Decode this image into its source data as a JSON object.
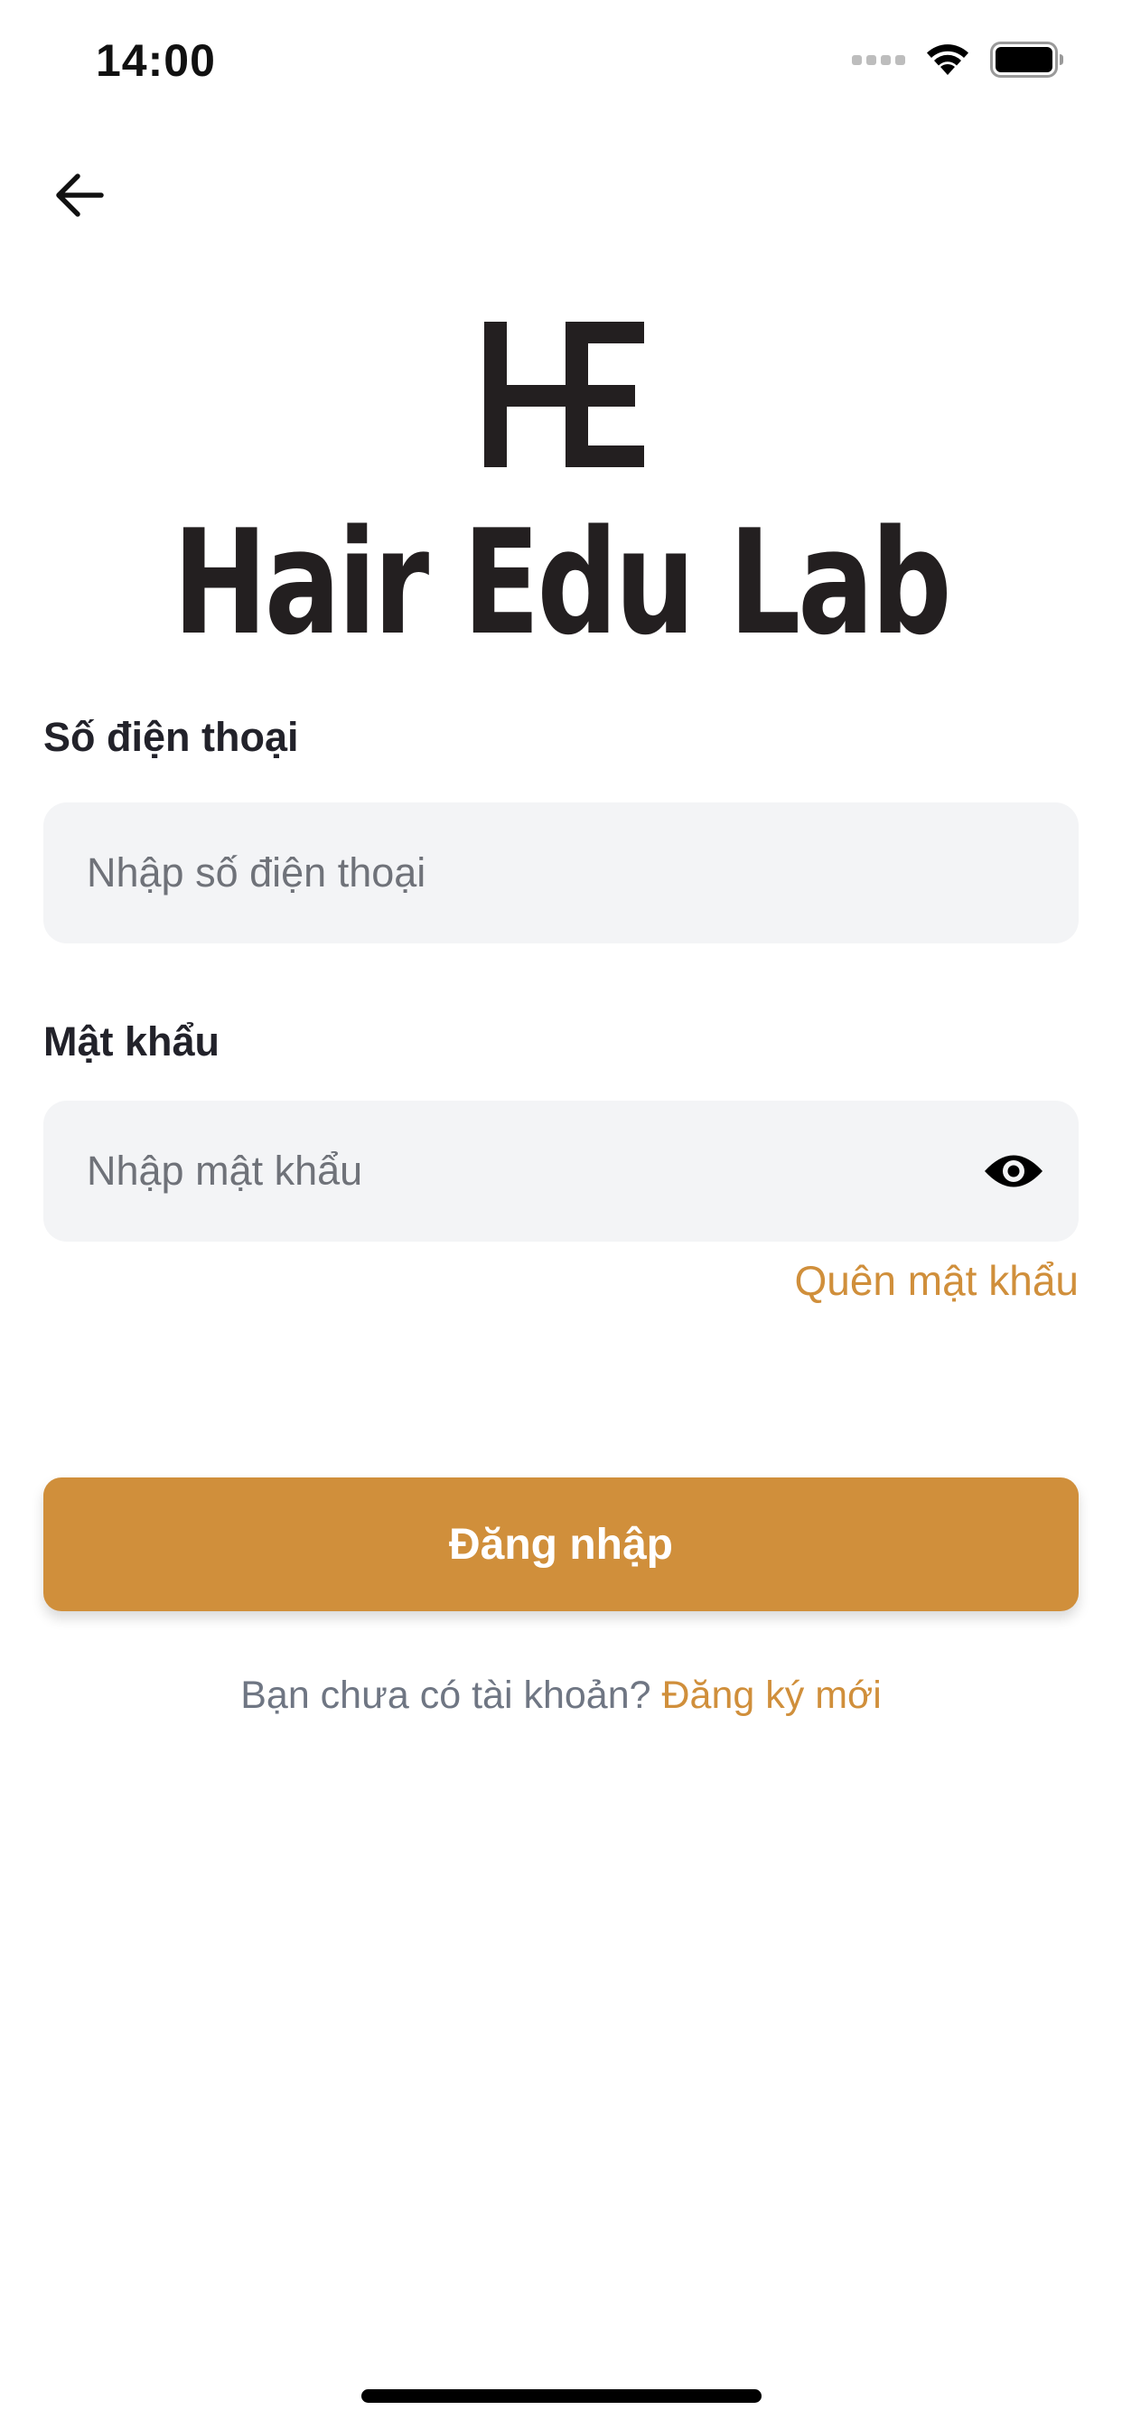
{
  "status_bar": {
    "time": "14:00"
  },
  "brand": {
    "name": "Hair Edu Lab",
    "color": "#231f20"
  },
  "form": {
    "phone_label": "Số điện thoại",
    "phone_placeholder": "Nhập số điện thoại",
    "phone_value": "",
    "password_label": "Mật khẩu",
    "password_placeholder": "Nhập mật khẩu",
    "password_value": "",
    "forgot_password": "Quên mật khẩu",
    "submit_label": "Đăng nhập"
  },
  "signup": {
    "prompt": "Bạn chưa có tài khoản?",
    "link": "Đăng ký mới"
  },
  "colors": {
    "accent": "#d08f3b",
    "input_bg": "#f3f4f6",
    "label": "#22222a",
    "muted": "#6f7683"
  },
  "icons": {
    "back": "arrow-left-icon",
    "password_toggle": "eye-icon",
    "wifi": "wifi-icon",
    "battery": "battery-icon",
    "signal": "signal-icon"
  }
}
